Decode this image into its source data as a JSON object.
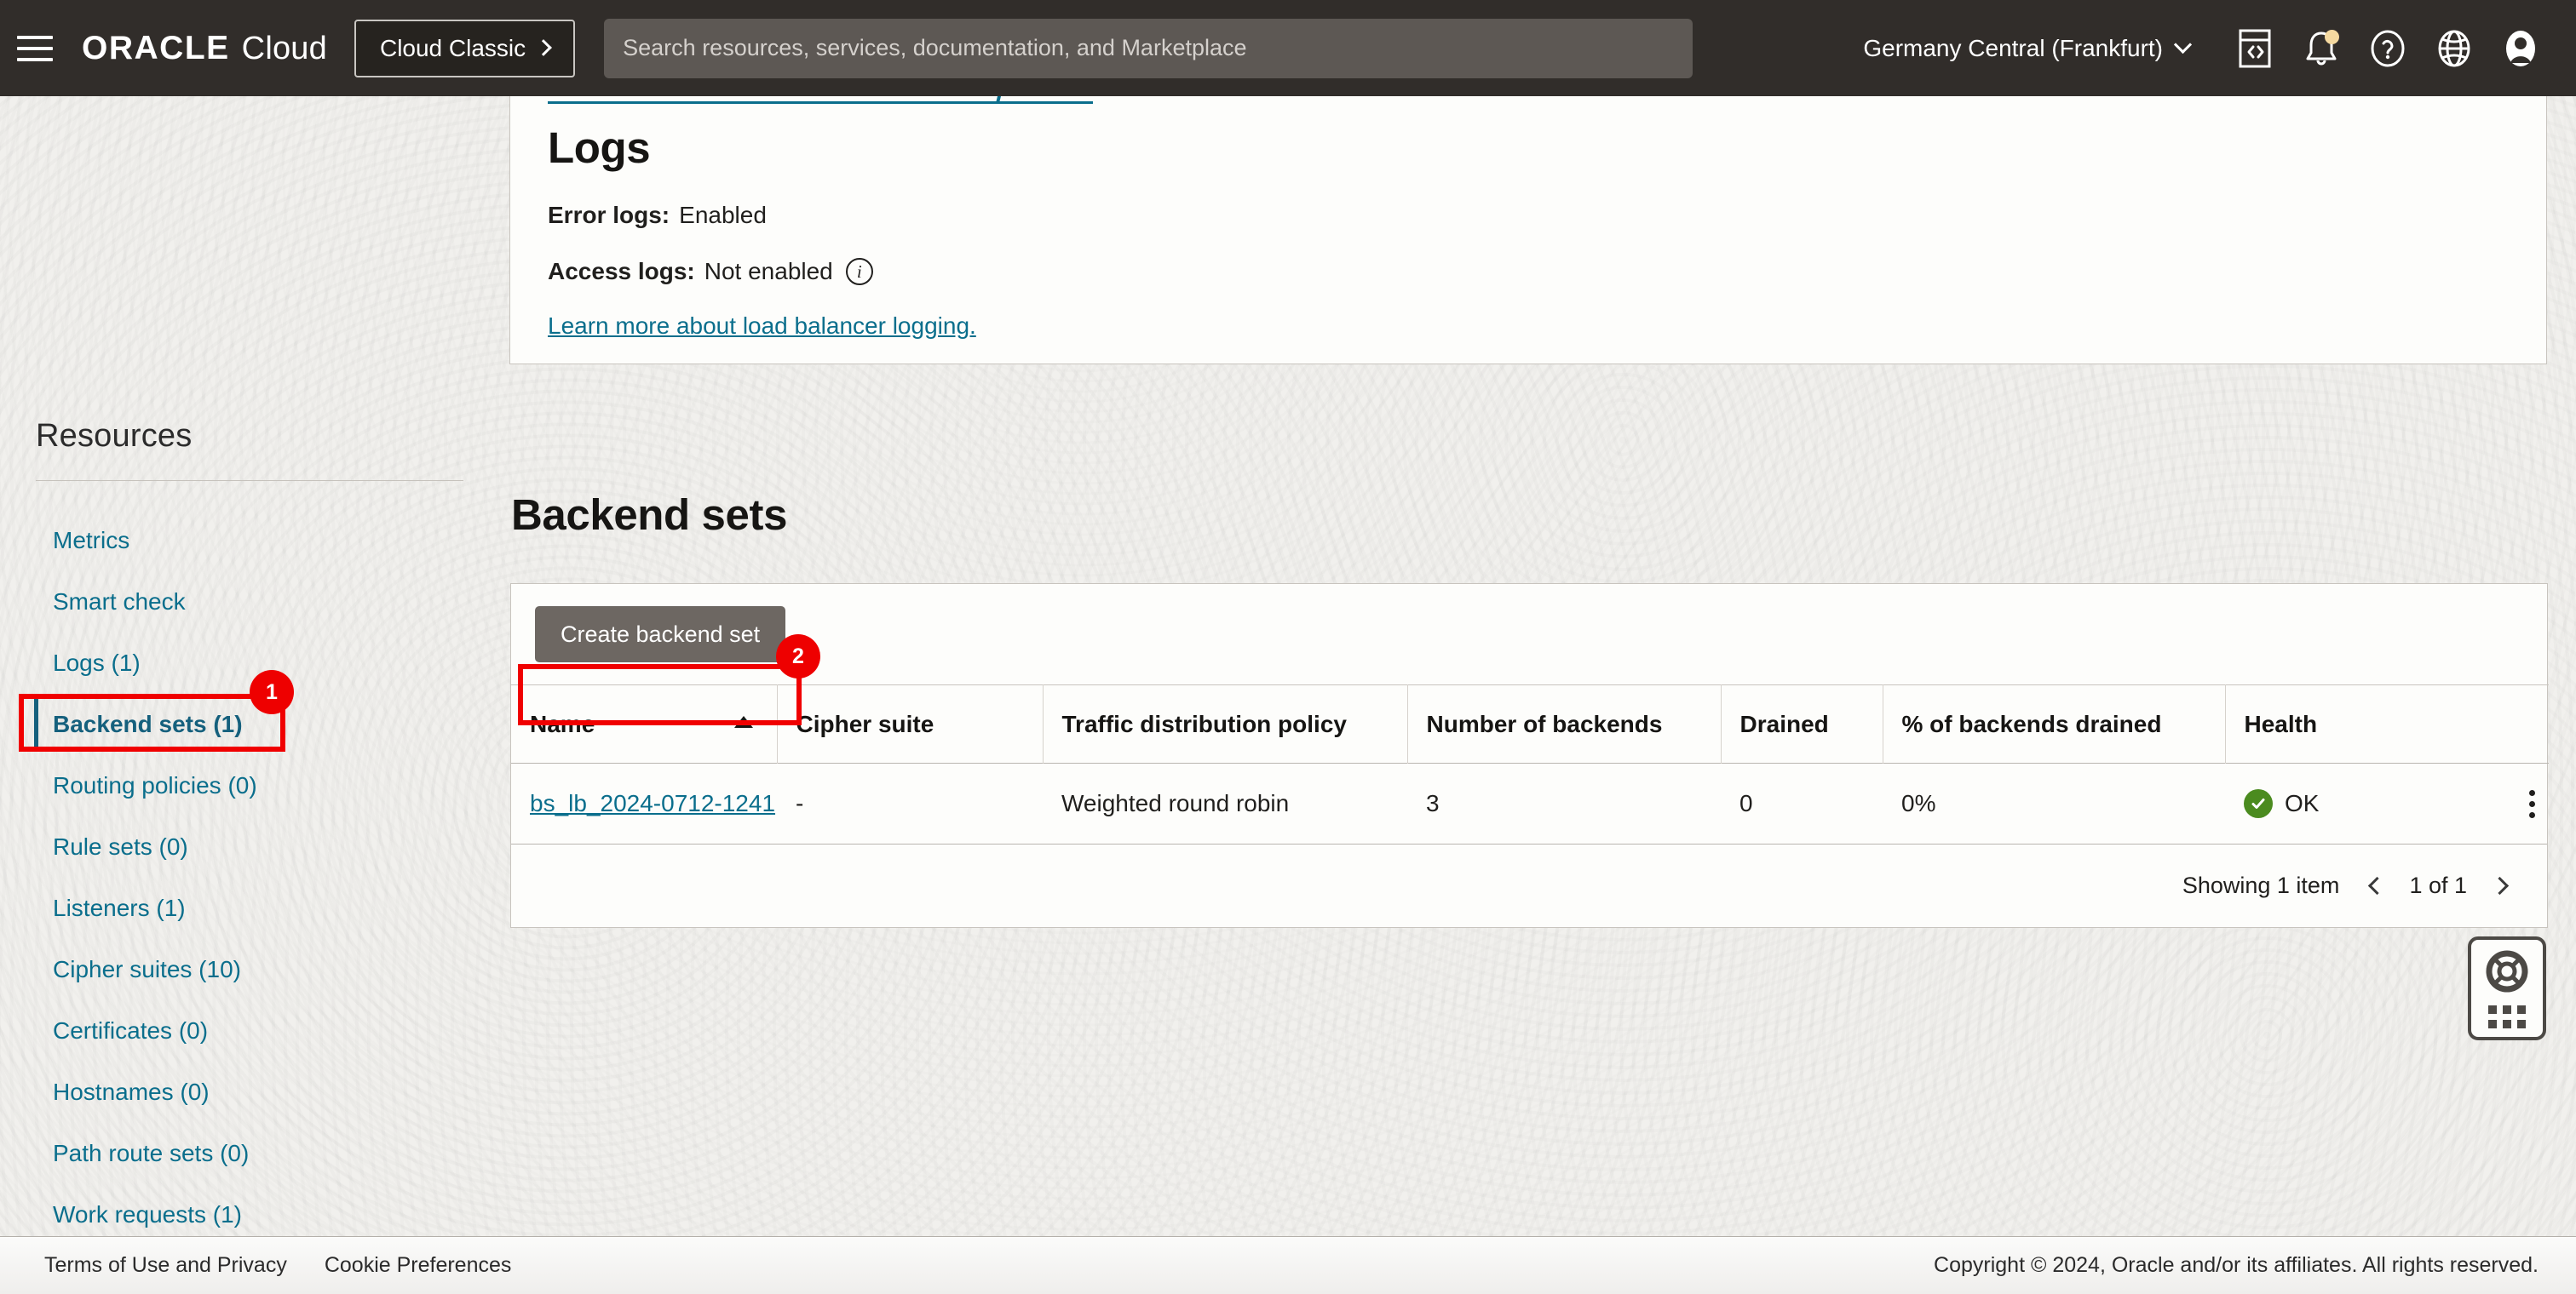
{
  "topbar": {
    "menu_icon": "hamburger-icon",
    "brand_oracle": "ORACLE",
    "brand_cloud": "Cloud",
    "cloud_classic_label": "Cloud Classic",
    "search_placeholder": "Search resources, services, documentation, and Marketplace",
    "search_value": "",
    "region": "Germany Central (Frankfurt)",
    "icons": [
      "code-editor-icon",
      "notifications-bell-icon",
      "help-question-icon",
      "language-globe-icon",
      "user-avatar-icon"
    ],
    "notification_dot_color": "#f5d9a0"
  },
  "sidebar": {
    "title": "Resources",
    "items": [
      {
        "label": "Metrics",
        "active": false
      },
      {
        "label": "Smart check",
        "active": false
      },
      {
        "label": "Logs (1)",
        "active": false
      },
      {
        "label": "Backend sets (1)",
        "active": true
      },
      {
        "label": "Routing policies (0)",
        "active": false
      },
      {
        "label": "Rule sets (0)",
        "active": false
      },
      {
        "label": "Listeners (1)",
        "active": false
      },
      {
        "label": "Cipher suites (10)",
        "active": false
      },
      {
        "label": "Certificates (0)",
        "active": false
      },
      {
        "label": "Hostnames (0)",
        "active": false
      },
      {
        "label": "Path route sets (0)",
        "active": false
      },
      {
        "label": "Work requests (1)",
        "active": false
      }
    ]
  },
  "logs_card": {
    "heading": "Logs",
    "error_logs_label": "Error logs:",
    "error_logs_value": "Enabled",
    "access_logs_label": "Access logs:",
    "access_logs_value": "Not enabled",
    "info_icon": "info-circle-icon",
    "learn_more": "Learn more about load balancer logging."
  },
  "backend_sets": {
    "heading": "Backend sets",
    "create_button": "Create backend set",
    "columns": [
      "Name",
      "Cipher suite",
      "Traffic distribution policy",
      "Number of backends",
      "Drained",
      "% of backends drained",
      "Health"
    ],
    "sort_column": "Name",
    "sort_direction": "ascending",
    "rows": [
      {
        "name": "bs_lb_2024-0712-1241",
        "cipher_suite": "-",
        "traffic_policy": "Weighted round robin",
        "number_of_backends": "3",
        "drained": "0",
        "pct_drained": "0%",
        "health": "OK",
        "health_color": "#4b8b1f"
      }
    ],
    "footer": {
      "showing": "Showing 1 item",
      "page": "1 of 1"
    }
  },
  "annotations": [
    {
      "id": "1",
      "target": "sidebar-item-backend-sets",
      "color": "#ee0000"
    },
    {
      "id": "2",
      "target": "backend-set-name-link",
      "color": "#ee0000"
    }
  ],
  "help_widget": {
    "icon": "lifebuoy-icon",
    "handle": "drag-grip-icon"
  },
  "footer": {
    "terms": "Terms of Use and Privacy",
    "cookies": "Cookie Preferences",
    "copyright": "Copyright © 2024, Oracle and/or its affiliates. All rights reserved."
  }
}
